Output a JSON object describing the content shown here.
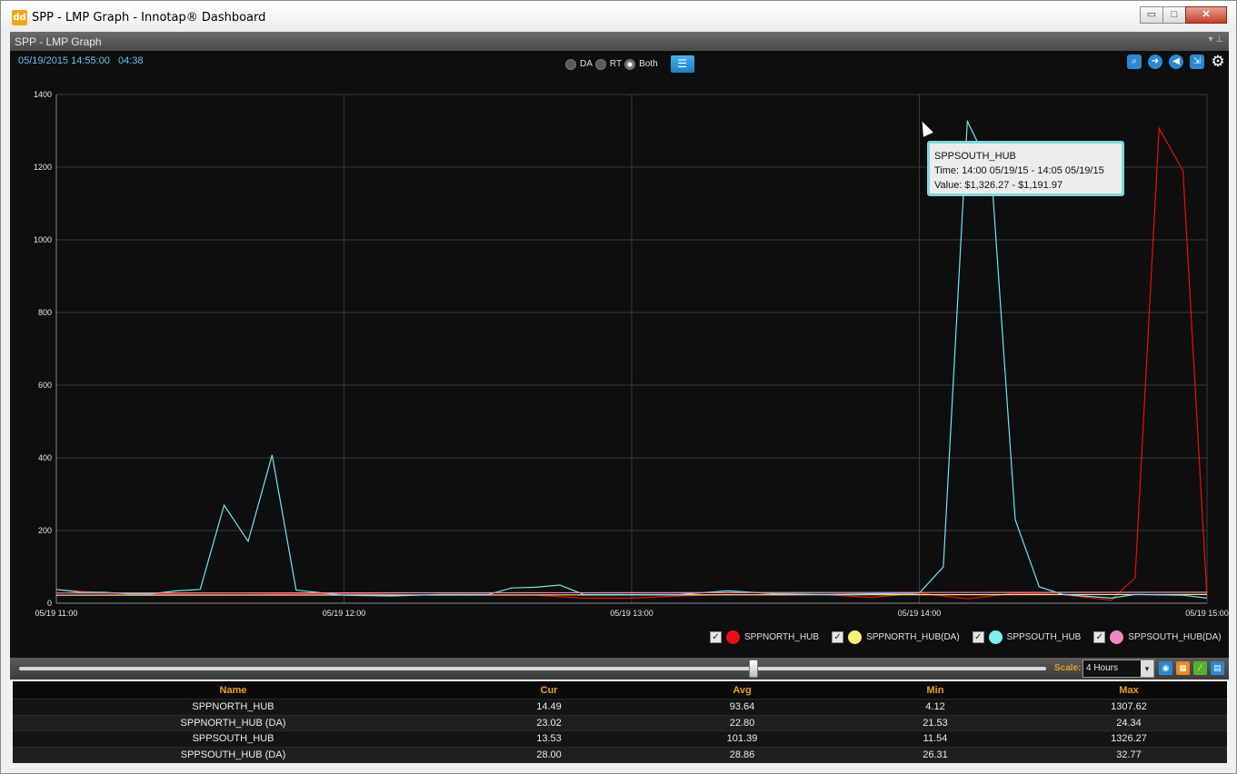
{
  "window": {
    "title": "SPP - LMP Graph - Innotap® Dashboard",
    "icon_label": "dd",
    "buttons": [
      "minimize",
      "maximize",
      "close"
    ]
  },
  "panel": {
    "title": "SPP - LMP Graph"
  },
  "header": {
    "datetime": "05/19/2015 14:55:00",
    "countdown": "04:38",
    "modes": [
      {
        "label": "DA",
        "selected": false
      },
      {
        "label": "RT",
        "selected": false
      },
      {
        "label": "Both",
        "selected": true
      }
    ],
    "tools": [
      "search-icon",
      "arrow-right-icon",
      "speaker-icon",
      "export-icon",
      "gear-icon"
    ]
  },
  "chart_data": {
    "type": "line",
    "x_labels": [
      "05/19 11:00",
      "05/19 12:00",
      "05/19 13:00",
      "05/19 14:00",
      "05/19 15:00"
    ],
    "x_range_minutes": [
      0,
      240
    ],
    "ylim": [
      0,
      1400
    ],
    "y_ticks": [
      0,
      200,
      400,
      600,
      800,
      1000,
      1200,
      1400
    ],
    "grid": true,
    "series": [
      {
        "name": "SPPNORTH_HUB",
        "color": "#e81010",
        "points": [
          [
            0,
            38
          ],
          [
            10,
            28
          ],
          [
            20,
            26
          ],
          [
            30,
            24
          ],
          [
            40,
            24
          ],
          [
            50,
            26
          ],
          [
            60,
            26
          ],
          [
            70,
            24
          ],
          [
            80,
            22
          ],
          [
            90,
            22
          ],
          [
            100,
            22
          ],
          [
            110,
            14
          ],
          [
            120,
            14
          ],
          [
            130,
            20
          ],
          [
            140,
            24
          ],
          [
            150,
            22
          ],
          [
            160,
            24
          ],
          [
            170,
            16
          ],
          [
            180,
            28
          ],
          [
            190,
            12
          ],
          [
            200,
            28
          ],
          [
            210,
            24
          ],
          [
            220,
            8
          ],
          [
            225,
            70
          ],
          [
            230,
            1307
          ],
          [
            235,
            1190
          ],
          [
            240,
            15
          ]
        ]
      },
      {
        "name": "SPPNORTH_HUB(DA)",
        "color": "#f0e870",
        "points": [
          [
            0,
            22
          ],
          [
            240,
            24
          ]
        ]
      },
      {
        "name": "SPPSOUTH_HUB",
        "color": "#70e8ee",
        "points": [
          [
            0,
            38
          ],
          [
            5,
            30
          ],
          [
            10,
            30
          ],
          [
            15,
            26
          ],
          [
            20,
            26
          ],
          [
            25,
            34
          ],
          [
            30,
            38
          ],
          [
            35,
            270
          ],
          [
            40,
            170
          ],
          [
            45,
            408
          ],
          [
            50,
            36
          ],
          [
            60,
            22
          ],
          [
            70,
            20
          ],
          [
            80,
            24
          ],
          [
            90,
            24
          ],
          [
            95,
            42
          ],
          [
            100,
            44
          ],
          [
            105,
            50
          ],
          [
            110,
            24
          ],
          [
            130,
            24
          ],
          [
            140,
            34
          ],
          [
            150,
            26
          ],
          [
            160,
            24
          ],
          [
            170,
            26
          ],
          [
            180,
            28
          ],
          [
            185,
            100
          ],
          [
            190,
            1326
          ],
          [
            195,
            1192
          ],
          [
            200,
            230
          ],
          [
            205,
            45
          ],
          [
            210,
            24
          ],
          [
            220,
            14
          ],
          [
            225,
            24
          ],
          [
            235,
            22
          ],
          [
            240,
            14
          ]
        ]
      },
      {
        "name": "SPPSOUTH_HUB(DA)",
        "color": "#f080c0",
        "points": [
          [
            0,
            28
          ],
          [
            240,
            30
          ]
        ]
      }
    ],
    "legend": [
      {
        "label": "SPPNORTH_HUB",
        "color": "#e81010",
        "checked": true
      },
      {
        "label": "SPPNORTH_HUB(DA)",
        "color": "#f8f07a",
        "checked": true
      },
      {
        "label": "SPPSOUTH_HUB",
        "color": "#7ef0f0",
        "checked": true
      },
      {
        "label": "SPPSOUTH_HUB(DA)",
        "color": "#f088c8",
        "checked": true
      }
    ]
  },
  "tooltip": {
    "title": "SPPSOUTH_HUB",
    "time": "Time: 14:00 05/19/15 - 14:05 05/19/15",
    "value": "Value: $1,326.27 - $1,191.97"
  },
  "scale": {
    "label": "Scale:",
    "selected": "4 Hours",
    "slider_position": 0.72
  },
  "table": {
    "columns": [
      "Name",
      "Cur",
      "Avg",
      "Min",
      "Max"
    ],
    "rows": [
      [
        "SPPNORTH_HUB",
        "14.49",
        "93.64",
        "4.12",
        "1307.62"
      ],
      [
        "SPPNORTH_HUB (DA)",
        "23.02",
        "22.80",
        "21.53",
        "24.34"
      ],
      [
        "SPPSOUTH_HUB",
        "13.53",
        "101.39",
        "11.54",
        "1326.27"
      ],
      [
        "SPPSOUTH_HUB (DA)",
        "28.00",
        "28.86",
        "26.31",
        "32.77"
      ]
    ]
  },
  "colors": {
    "accent": "#e8a020",
    "timestamp": "#6cc0ee",
    "background": "#0e0e0e"
  }
}
